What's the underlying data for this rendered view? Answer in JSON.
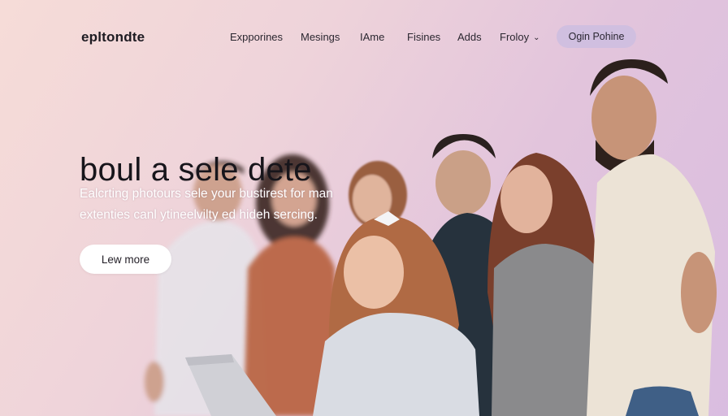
{
  "brand": {
    "logo_text": "epltondte"
  },
  "nav": {
    "items": [
      {
        "label": "Expporines"
      },
      {
        "label": "Mesings"
      },
      {
        "label": "IAme"
      },
      {
        "label": "Fisines"
      },
      {
        "label": "Adds"
      },
      {
        "label": "Froloy",
        "has_dropdown": true
      }
    ],
    "cta_label": "Ogin Pohine"
  },
  "hero": {
    "title": "boul a sele dete",
    "subtitle_line1": "Ealcrting photours sele your bustirest for man",
    "subtitle_line2": "extenties canl ytineelvilty ed hideh sercing.",
    "button_label": "Lew more"
  },
  "icons": {
    "dropdown": "chevron-down-icon"
  },
  "colors": {
    "background_start": "#f6dcd8",
    "background_end": "#d9bde0",
    "cta_bg": "#d0bfe0",
    "text_dark": "#17151b"
  }
}
